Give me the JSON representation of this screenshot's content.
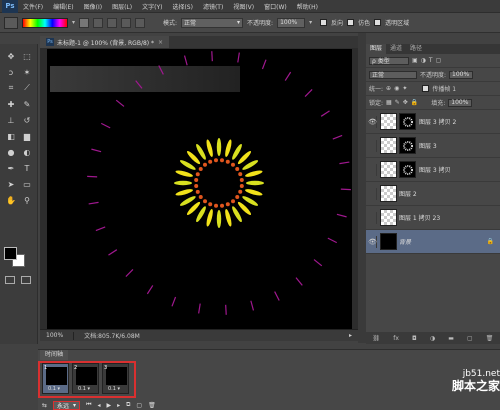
{
  "app": {
    "logo": "Ps"
  },
  "menu": [
    "文件(F)",
    "编辑(E)",
    "图像(I)",
    "图层(L)",
    "文字(Y)",
    "选择(S)",
    "滤镜(T)",
    "视图(V)",
    "窗口(W)",
    "帮助(H)"
  ],
  "options": {
    "mode_label": "模式:",
    "mode_value": "正常",
    "opacity_label": "不透明度:",
    "opacity_value": "100%",
    "reverse_label": "反向",
    "dither_label": "仿色",
    "transparency_label": "透明区域"
  },
  "document": {
    "tab_title": "未标题-1 @ 100% (背景, RGB/8) *",
    "zoom": "100%",
    "doc_info": "文档:805.7K/6.08M"
  },
  "layers": {
    "tabs": [
      "图层",
      "通道",
      "路径"
    ],
    "filter_kind": "ρ 类型",
    "blend_mode": "正常",
    "opacity_label": "不透明度:",
    "opacity_value": "100%",
    "unify_label": "统一:",
    "propagate_label": "传播帧 1",
    "lock_label": "锁定:",
    "fill_label": "填充:",
    "fill_value": "100%",
    "items": [
      {
        "name": "图层 3 拷贝 2",
        "visible": true
      },
      {
        "name": "图层 3",
        "visible": false
      },
      {
        "name": "图层 3 拷贝",
        "visible": false
      },
      {
        "name": "图层 2",
        "visible": false
      },
      {
        "name": "图层 1 拷贝 23",
        "visible": false
      },
      {
        "name": "背景",
        "visible": true
      }
    ]
  },
  "timeline": {
    "tab": "时间轴",
    "frames": [
      {
        "num": "1",
        "delay": "0.1 ▾"
      },
      {
        "num": "2",
        "delay": "0.1 ▾"
      },
      {
        "num": "3",
        "delay": "0.1 ▾"
      }
    ],
    "loop": "永远"
  },
  "watermark": {
    "line1": "jb51.net",
    "line2": "脚本之家"
  }
}
